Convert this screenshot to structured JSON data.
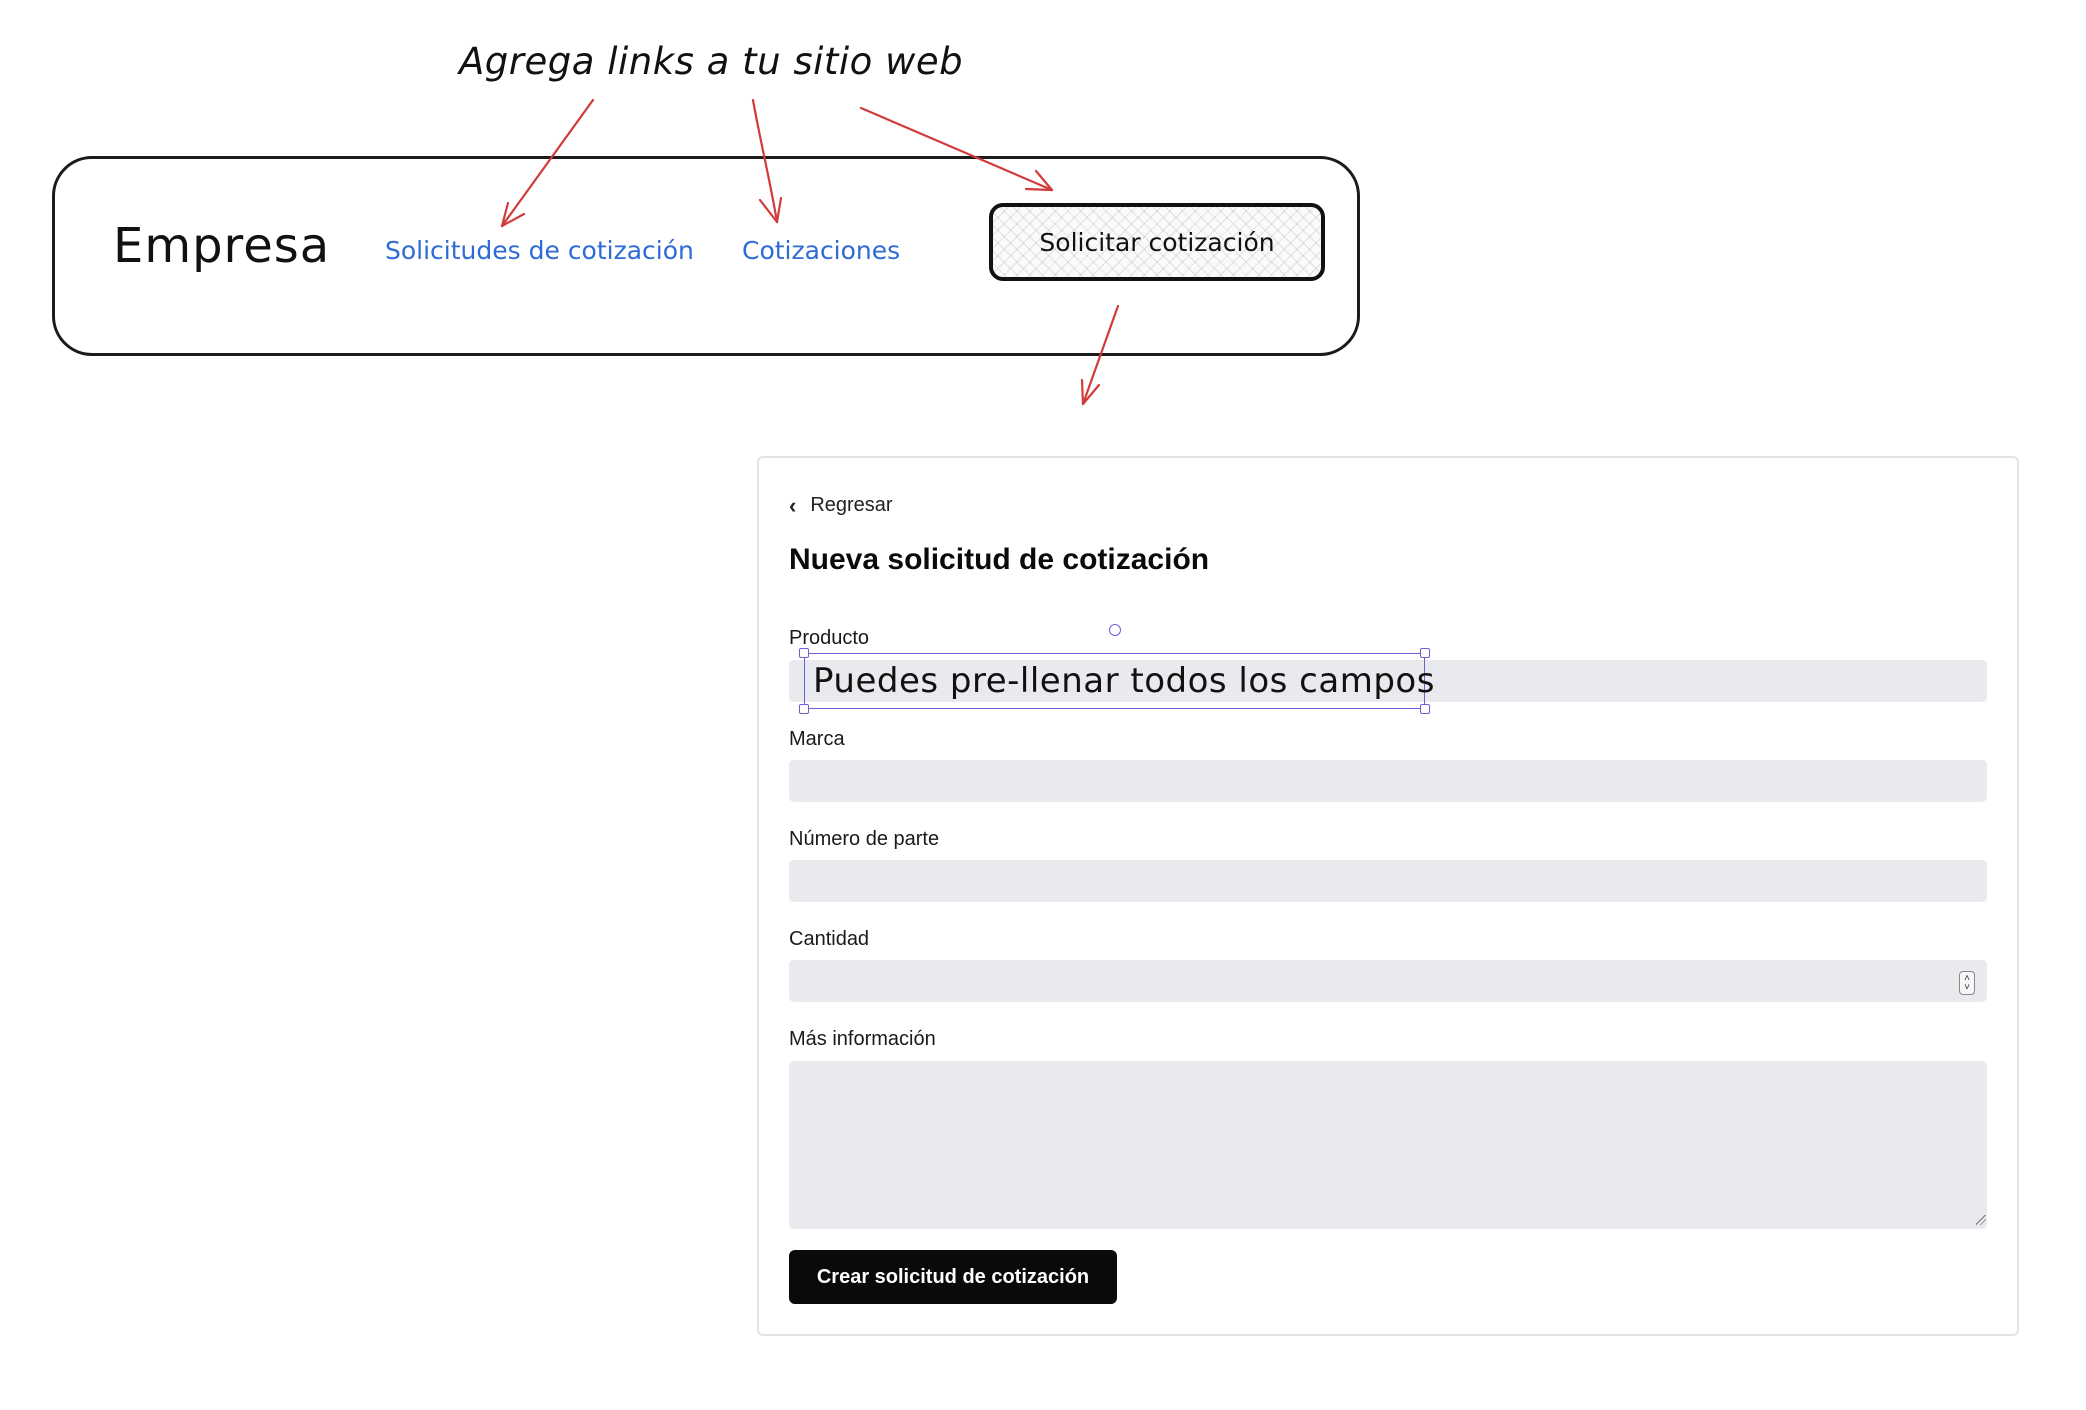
{
  "annotation": {
    "title": "Agrega links a tu sitio web",
    "overlay_text": "Puedes pre-llenar todos los campos"
  },
  "sketch_nav": {
    "brand": "Empresa",
    "links": [
      "Solicitudes de cotización",
      "Cotizaciones"
    ],
    "button_label": "Solicitar cotización"
  },
  "form": {
    "back_label": "Regresar",
    "title": "Nueva solicitud de cotización",
    "fields": [
      {
        "label": "Producto",
        "value": ""
      },
      {
        "label": "Marca",
        "value": ""
      },
      {
        "label": "Número de parte",
        "value": ""
      },
      {
        "label": "Cantidad",
        "value": ""
      },
      {
        "label": "Más información",
        "value": ""
      }
    ],
    "submit_label": "Crear solicitud de cotización"
  },
  "colors": {
    "link": "#2e6bd6",
    "arrow": "#d13b3b",
    "selection": "#6b5fd6",
    "input_bg": "#e8eaed",
    "button_bg": "#0a0a0a"
  }
}
